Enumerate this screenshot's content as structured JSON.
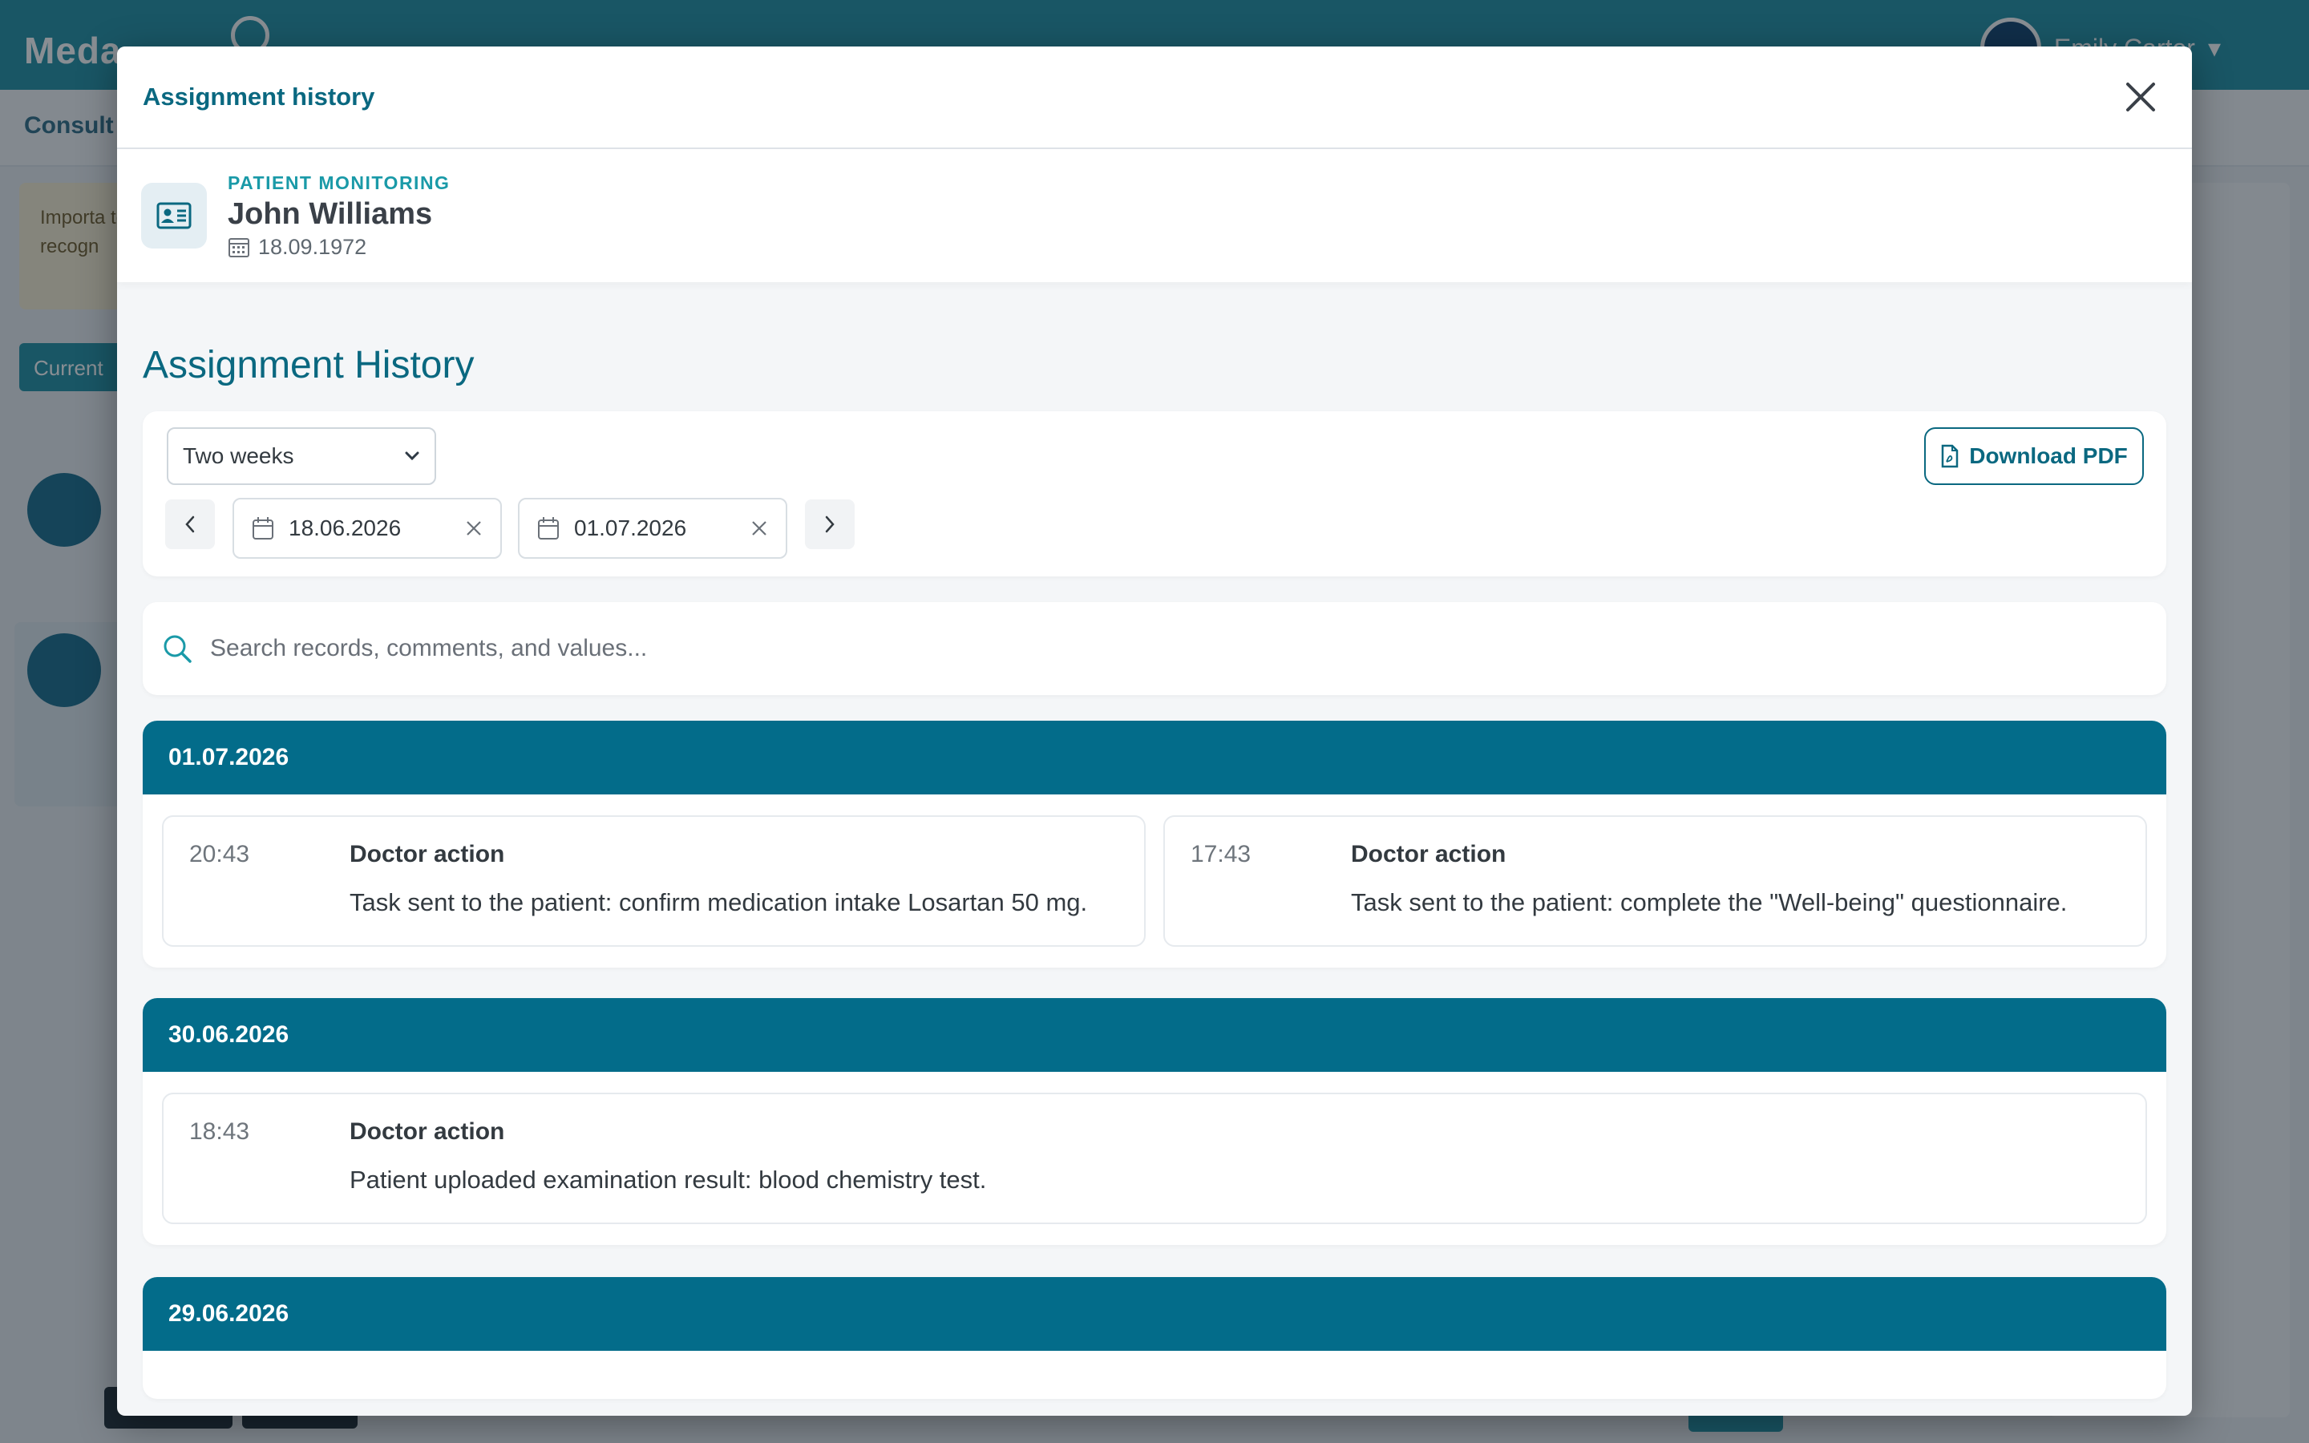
{
  "background": {
    "logo": "Meda",
    "user_name": "Emily Carter",
    "subbar_label": "Consult",
    "notice_text": "Importa to make recogn",
    "current_label": "Current"
  },
  "modal": {
    "title": "Assignment history"
  },
  "patient": {
    "label": "PATIENT MONITORING",
    "name": "John Williams",
    "dob": "18.09.1972"
  },
  "history": {
    "title": "Assignment History",
    "period_select": "Two weeks",
    "download_label": "Download PDF",
    "date_from": "18.06.2026",
    "date_to": "01.07.2026",
    "search_placeholder": "Search records, comments, and values..."
  },
  "days": [
    {
      "date": "01.07.2026",
      "entries": [
        {
          "time": "20:43",
          "type": "Doctor action",
          "text": "Task sent to the patient: confirm medication intake Losartan 50 mg."
        },
        {
          "time": "17:43",
          "type": "Doctor action",
          "text": "Task sent to the patient: complete the \"Well-being\" questionnaire."
        }
      ]
    },
    {
      "date": "30.06.2026",
      "entries": [
        {
          "time": "18:43",
          "type": "Doctor action",
          "text": "Patient uploaded examination result: blood chemistry test."
        }
      ]
    },
    {
      "date": "29.06.2026",
      "entries": []
    }
  ],
  "colors": {
    "accent": "#0a6880",
    "day_header": "#036c8a",
    "teal_label": "#1a9aa8"
  }
}
